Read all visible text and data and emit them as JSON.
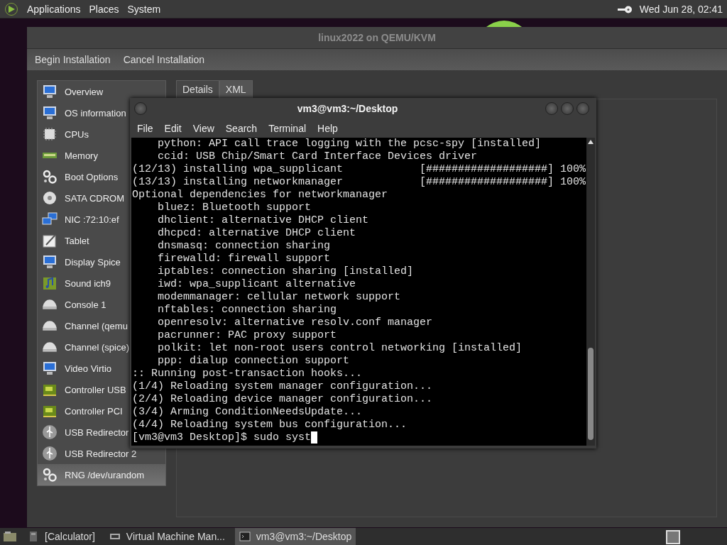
{
  "top_panel": {
    "menus": [
      "Applications",
      "Places",
      "System"
    ],
    "clock": "Wed Jun 28, 02:41"
  },
  "vm_window": {
    "title": "linux2022 on QEMU/KVM",
    "toolbar": [
      "Begin Installation",
      "Cancel Installation"
    ],
    "hardware_list": [
      {
        "label": "Overview",
        "kind": "monitor",
        "selected": false
      },
      {
        "label": "OS information",
        "kind": "monitor",
        "selected": false
      },
      {
        "label": "CPUs",
        "kind": "chip",
        "selected": false
      },
      {
        "label": "Memory",
        "kind": "memory",
        "selected": false
      },
      {
        "label": "Boot Options",
        "kind": "gears",
        "selected": false
      },
      {
        "label": "SATA CDROM",
        "kind": "disc",
        "selected": false
      },
      {
        "label": "NIC :72:10:ef",
        "kind": "network",
        "selected": false
      },
      {
        "label": "Tablet",
        "kind": "tablet",
        "selected": false
      },
      {
        "label": "Display Spice",
        "kind": "monitor",
        "selected": false
      },
      {
        "label": "Sound ich9",
        "kind": "sound",
        "selected": false
      },
      {
        "label": "Console 1",
        "kind": "serial",
        "selected": false
      },
      {
        "label": "Channel (qemu",
        "kind": "serial",
        "selected": false
      },
      {
        "label": "Channel (spice)",
        "kind": "serial",
        "selected": false
      },
      {
        "label": "Video Virtio",
        "kind": "monitor",
        "selected": false
      },
      {
        "label": "Controller USB",
        "kind": "card",
        "selected": false
      },
      {
        "label": "Controller PCI",
        "kind": "card",
        "selected": false
      },
      {
        "label": "USB Redirector",
        "kind": "usb",
        "selected": false
      },
      {
        "label": "USB Redirector 2",
        "kind": "usb",
        "selected": false
      },
      {
        "label": "RNG /dev/urandom",
        "kind": "gears",
        "selected": true
      }
    ],
    "tabs": [
      {
        "label": "Details",
        "selected": true
      },
      {
        "label": "XML",
        "selected": false
      }
    ]
  },
  "terminal": {
    "title": "vm3@vm3:~/Desktop",
    "menus": [
      "File",
      "Edit",
      "View",
      "Search",
      "Terminal",
      "Help"
    ],
    "lines": [
      "    python: API call trace logging with the pcsc-spy [installed]",
      "    ccid: USB Chip/Smart Card Interface Devices driver",
      "(12/13) installing wpa_supplicant            [###################] 100%",
      "(13/13) installing networkmanager            [###################] 100%",
      "Optional dependencies for networkmanager",
      "    bluez: Bluetooth support",
      "    dhclient: alternative DHCP client",
      "    dhcpcd: alternative DHCP client",
      "    dnsmasq: connection sharing",
      "    firewalld: firewall support",
      "    iptables: connection sharing [installed]",
      "    iwd: wpa_supplicant alternative",
      "    modemmanager: cellular network support",
      "    nftables: connection sharing",
      "    openresolv: alternative resolv.conf manager",
      "    pacrunner: PAC proxy support",
      "    polkit: let non-root users control networking [installed]",
      "    ppp: dialup connection support",
      ":: Running post-transaction hooks...",
      "(1/4) Reloading system manager configuration...",
      "(2/4) Reloading device manager configuration...",
      "(3/4) Arming ConditionNeedsUpdate...",
      "(4/4) Reloading system bus configuration...",
      "[vm3@vm3 Desktop]$ sudo syst"
    ],
    "cursor_visible": true
  },
  "taskbar": {
    "items": [
      {
        "label": "[Calculator]",
        "kind": "calculator",
        "selected": false
      },
      {
        "label": "Virtual Machine Man...",
        "kind": "vm",
        "selected": false
      },
      {
        "label": "vm3@vm3:~/Desktop",
        "kind": "terminal",
        "selected": true
      }
    ]
  }
}
